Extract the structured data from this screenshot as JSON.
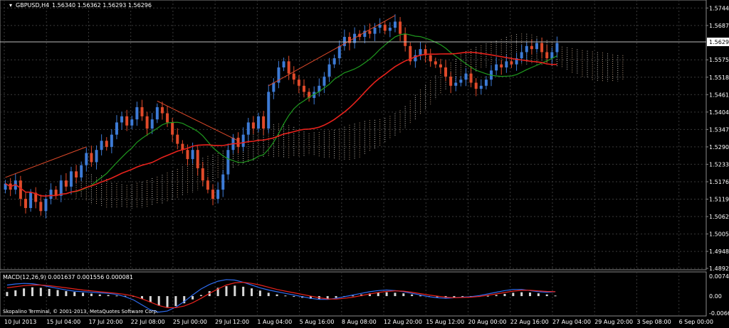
{
  "header": {
    "symbol": "GBPUSD,H4",
    "ohlc": "1.56340 1.56362 1.56293 1.56296"
  },
  "macd": {
    "label": "MACD(12,26,9) 0.001637 0.001556 0.000081"
  },
  "footer": {
    "copyright": "Skopalino Terminal, © 2001-2013, MetaQuotes Software Corp."
  },
  "colors": {
    "background": "#000000",
    "grid": "#3a3a3a",
    "bull_candle": "#3d7bd6",
    "bear_candle": "#e04a2a",
    "ma_fast": "#1f9a1f",
    "ma_slow": "#e8221c",
    "cloud_up": "#c9a98a",
    "cloud_down": "#e6e0d8",
    "price_line": "#bdbdbd",
    "macd_line": "#2e6cf0",
    "signal_line": "#e8221c",
    "histogram": "#d9d9d9"
  },
  "chart_data": {
    "type": "candlestick",
    "symbol": "GBPUSD",
    "timeframe": "H4",
    "current_price": "1.56296",
    "y_ticks": [
      "1.57445",
      "1.56873",
      "1.56296",
      "1.55750",
      "1.55180",
      "1.54610",
      "1.54040",
      "1.53470",
      "1.52900",
      "1.52330",
      "1.51760",
      "1.51190",
      "1.50620",
      "1.50050",
      "1.49480",
      "1.48925"
    ],
    "x_ticks": [
      "10 Jul 2013",
      "15 Jul 04:00",
      "17 Jul 20:00",
      "22 Jul 08:00",
      "25 Jul 00:00",
      "29 Jul 12:00",
      "1 Aug 04:00",
      "5 Aug 16:00",
      "8 Aug 08:00",
      "12 Aug 20:00",
      "15 Aug 12:00",
      "20 Aug 00:00",
      "22 Aug 16:00",
      "27 Aug 04:00",
      "29 Aug 20:00",
      "3 Sep 08:00",
      "6 Sep 00:00"
    ],
    "ylim": [
      1.48925,
      1.5766
    ],
    "close": [
      1.517,
      1.515,
      1.518,
      1.512,
      1.509,
      1.514,
      1.511,
      1.508,
      1.512,
      1.515,
      1.513,
      1.518,
      1.516,
      1.521,
      1.519,
      1.523,
      1.527,
      1.524,
      1.528,
      1.531,
      1.529,
      1.533,
      1.537,
      1.539,
      1.536,
      1.538,
      1.542,
      1.539,
      1.535,
      1.538,
      1.542,
      1.54,
      1.537,
      1.533,
      1.53,
      1.528,
      1.525,
      1.528,
      1.522,
      1.518,
      1.515,
      1.512,
      1.515,
      1.52,
      1.528,
      1.532,
      1.529,
      1.533,
      1.537,
      1.535,
      1.539,
      1.535,
      1.547,
      1.55,
      1.555,
      1.557,
      1.553,
      1.551,
      1.549,
      1.547,
      1.545,
      1.547,
      1.549,
      1.552,
      1.556,
      1.558,
      1.562,
      1.565,
      1.563,
      1.566,
      1.565,
      1.567,
      1.566,
      1.568,
      1.569,
      1.567,
      1.568,
      1.57,
      1.566,
      1.562,
      1.557,
      1.559,
      1.561,
      1.559,
      1.557,
      1.556,
      1.555,
      1.552,
      1.549,
      1.55,
      1.551,
      1.553,
      1.55,
      1.548,
      1.549,
      1.551,
      1.554,
      1.556,
      1.555,
      1.557,
      1.556,
      1.558,
      1.56,
      1.562,
      1.561,
      1.563,
      1.56,
      1.558,
      1.56,
      1.563
    ],
    "macd_ylim": [
      -0.00667,
      0.00748
    ],
    "macd_ticks": [
      "0.007484",
      "0.00",
      "-0.006667"
    ],
    "macd_hist": [
      0.0015,
      0.0021,
      0.0028,
      0.0032,
      0.003,
      0.0026,
      0.0022,
      0.0018,
      0.0015,
      0.0012,
      0.0009,
      0.0006,
      0.0004,
      0.0002,
      0.0001,
      -0.0002,
      -0.001,
      -0.0022,
      -0.0035,
      -0.004,
      -0.0036,
      -0.0026,
      -0.0012,
      0.0004,
      0.0018,
      0.003,
      0.0036,
      0.0038,
      0.0034,
      0.0028,
      0.002,
      0.0012,
      0.0006,
      0.0002,
      -0.0002,
      -0.0006,
      -0.001,
      -0.0012,
      -0.001,
      -0.0006,
      -0.0002,
      0.0002,
      0.0006,
      0.001,
      0.0012,
      0.0014,
      0.0012,
      0.001,
      0.0006,
      0.0002,
      -0.0002,
      -0.0004,
      -0.0006,
      -0.0005,
      -0.0004,
      -0.0003,
      -0.0002,
      0.0001,
      0.0004,
      0.0008,
      0.0012,
      0.0014,
      0.0013,
      0.001,
      0.0006,
      0.0002
    ],
    "macd_line": [
      0.004,
      0.0044,
      0.0046,
      0.0045,
      0.004,
      0.0034,
      0.0028,
      0.0022,
      0.0018,
      0.0016,
      0.0014,
      0.0012,
      0.001,
      0.0006,
      -0.0002,
      -0.0014,
      -0.0032,
      -0.005,
      -0.0058,
      -0.0054,
      -0.004,
      -0.002,
      0.0004,
      0.0026,
      0.0042,
      0.0054,
      0.006,
      0.0058,
      0.005,
      0.004,
      0.003,
      0.0022,
      0.0016,
      0.001,
      0.0004,
      -0.0002,
      -0.0008,
      -0.0012,
      -0.0012,
      -0.0008,
      -0.0002,
      0.0004,
      0.001,
      0.0016,
      0.002,
      0.0022,
      0.002,
      0.0016,
      0.001,
      0.0004,
      -0.0002,
      -0.0006,
      -0.0008,
      -0.0006,
      -0.0004,
      -0.0002,
      0.0002,
      0.0008,
      0.0014,
      0.002,
      0.0024,
      0.0024,
      0.002,
      0.0016,
      0.0014,
      0.0016
    ],
    "signal_line": [
      0.003,
      0.0034,
      0.0038,
      0.004,
      0.004,
      0.0038,
      0.0034,
      0.003,
      0.0026,
      0.0022,
      0.0019,
      0.0016,
      0.0013,
      0.001,
      0.0006,
      0.0,
      -0.001,
      -0.0022,
      -0.0034,
      -0.0042,
      -0.0042,
      -0.0036,
      -0.0024,
      -0.0008,
      0.001,
      0.0026,
      0.004,
      0.0048,
      0.005,
      0.0046,
      0.004,
      0.0032,
      0.0024,
      0.0018,
      0.0012,
      0.0006,
      0.0,
      -0.0006,
      -0.001,
      -0.0011,
      -0.0008,
      -0.0004,
      0.0002,
      0.0008,
      0.0013,
      0.0017,
      0.0019,
      0.0018,
      0.0014,
      0.0009,
      0.0004,
      0.0,
      -0.0004,
      -0.0006,
      -0.0005,
      -0.0004,
      -0.0001,
      0.0003,
      0.0008,
      0.0013,
      0.0018,
      0.0021,
      0.0021,
      0.0019,
      0.0017,
      0.0016
    ]
  }
}
